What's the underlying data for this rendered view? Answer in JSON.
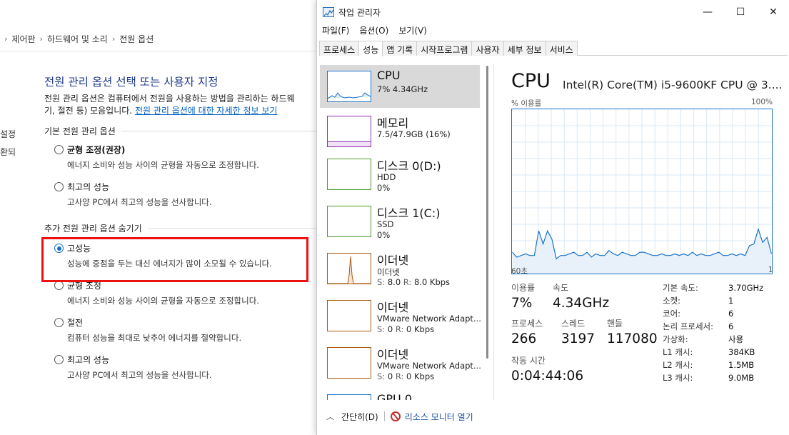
{
  "control_panel": {
    "breadcrumb": [
      "제어판",
      "하드웨어 및 소리",
      "전원 옵션"
    ],
    "side_items": [
      "설정",
      "환되"
    ],
    "title": "전원 관리 옵션 선택 또는 사용자 지정",
    "desc_line1": "전원 관리 옵션은 컴퓨터에서 전원을 사용하는 방법을 관리하는 하드웨",
    "desc_line2_prefix": "기, 절전 등) 모음입니다. ",
    "desc_link": "전원 관리 옵션에 대한 자세한 정보 보기",
    "section_basic": "기본 전원 관리 옵션",
    "section_extra": "추가 전원 관리 옵션 숨기기",
    "plans": [
      {
        "name": "균형 조정(권장)",
        "desc": "에너지 소비와 성능 사이의 균형을 자동으로 조정합니다."
      },
      {
        "name": "최고의 성능",
        "desc": "고사양 PC에서 최고의 성능을 선사합니다."
      },
      {
        "name": "고성능",
        "desc": "성능에 중점을 두는 대신 에너지가 많이 소모될 수 있습니다."
      },
      {
        "name": "균형 조정",
        "desc": "에너지 소비와 성능 사이의 균형을 자동으로 조정합니다."
      },
      {
        "name": "절전",
        "desc": "컴퓨터 성능을 최대로 낮추어 에너지를 절약합니다."
      },
      {
        "name": "최고의 성능",
        "desc": "고사양 PC에서 최고의 성능을 선사합니다."
      }
    ]
  },
  "task_manager": {
    "title": "작업 관리자",
    "window_buttons": {
      "minimize": "—",
      "maximize": "☐",
      "close": "✕"
    },
    "menu": [
      "파일(F)",
      "옵션(O)",
      "보기(V)"
    ],
    "tabs": [
      "프로세스",
      "성능",
      "앱 기록",
      "시작프로그램",
      "사용자",
      "세부 정보",
      "서비스"
    ],
    "active_tab": "성능",
    "resources": [
      {
        "label": "CPU",
        "v1": "7% 4.34GHz",
        "color": "#1a73c9"
      },
      {
        "label": "메모리",
        "v1": "7.5/47.9GB (16%)",
        "color": "#8b2fb0"
      },
      {
        "label": "디스크 0(D:)",
        "v1": "HDD",
        "v2": "0%",
        "color": "#4c9a2a"
      },
      {
        "label": "디스크 1(C:)",
        "v1": "SSD",
        "v2": "0%",
        "color": "#4c9a2a"
      },
      {
        "label": "이더넷",
        "v1": "이더넷",
        "v2s": "S:",
        "v2sv": "8.0",
        "v2r": "R:",
        "v2rv": "8.0 Kbps",
        "color": "#a75a10"
      },
      {
        "label": "이더넷",
        "v1": "VMware Network Adapt...",
        "v2s": "S:",
        "v2sv": "0",
        "v2r": "R:",
        "v2rv": "0 Kbps",
        "color": "#a75a10"
      },
      {
        "label": "이더넷",
        "v1": "VMware Network Adapt...",
        "v2s": "S:",
        "v2sv": "0",
        "v2r": "R:",
        "v2rv": "0 Kbps",
        "color": "#a75a10"
      },
      {
        "label": "GPU 0",
        "color": "#1a73c9"
      }
    ],
    "cpu": {
      "title": "CPU",
      "model": "Intel(R) Core(TM) i5-9600KF CPU @ 3....",
      "usage_axis_label": "% 이용률",
      "axis_max": "100%",
      "axis_left": "60초",
      "axis_right": "1",
      "stats": {
        "usage_label": "이용률",
        "usage": "7%",
        "speed_label": "속도",
        "speed": "4.34GHz",
        "processes_label": "프로세스",
        "processes": "266",
        "threads_label": "스레드",
        "threads": "3197",
        "handles_label": "핸들",
        "handles": "117080",
        "uptime_label": "작동 시간",
        "uptime": "0:04:44:06"
      },
      "specs": [
        {
          "k": "기본 속도:",
          "v": "3.70GHz"
        },
        {
          "k": "소켓:",
          "v": "1"
        },
        {
          "k": "코어:",
          "v": "6"
        },
        {
          "k": "논리 프로세서:",
          "v": "6"
        },
        {
          "k": "가상화:",
          "v": "사용"
        },
        {
          "k": "L1 캐시:",
          "v": "384KB"
        },
        {
          "k": "L2 캐시:",
          "v": "1.5MB"
        },
        {
          "k": "L3 캐시:",
          "v": "9.0MB"
        }
      ],
      "history_percent": [
        13,
        10,
        11,
        12,
        11,
        11,
        26,
        18,
        26,
        21,
        9,
        11,
        11,
        12,
        13,
        11,
        11,
        13,
        10,
        12,
        11,
        11,
        14,
        12,
        11,
        13,
        12,
        11,
        11,
        13,
        13,
        12,
        11,
        11,
        12,
        11,
        11,
        12,
        11,
        12,
        11,
        13,
        11,
        12,
        11,
        11,
        12,
        13,
        11,
        11,
        12,
        11,
        12,
        11,
        17,
        18,
        27,
        19,
        22,
        12
      ]
    },
    "footer": {
      "collapse": "간단히(D)",
      "monitor": "리소스 모니터 열기"
    }
  }
}
